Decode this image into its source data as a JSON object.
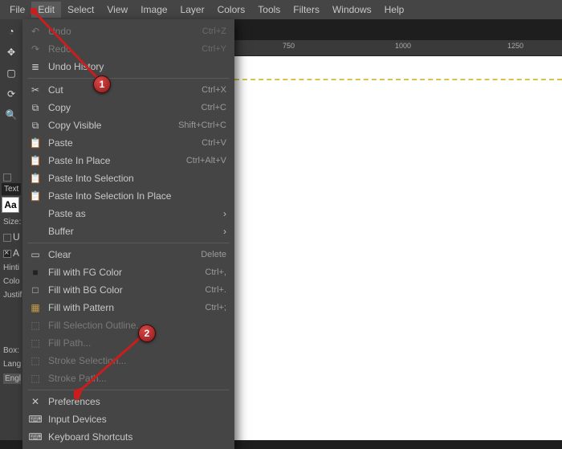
{
  "menubar": [
    "File",
    "Edit",
    "Select",
    "View",
    "Image",
    "Layer",
    "Colors",
    "Tools",
    "Filters",
    "Windows",
    "Help"
  ],
  "menubar_active_index": 1,
  "ruler_h": [
    "750",
    "1000",
    "1250"
  ],
  "ruler_positions": [
    60,
    200,
    340
  ],
  "dropdown": {
    "groups": [
      [
        {
          "icon": "undo",
          "label": "Undo",
          "shortcut": "Ctrl+Z",
          "disabled": true
        },
        {
          "icon": "redo",
          "label": "Redo",
          "shortcut": "Ctrl+Y",
          "disabled": true
        },
        {
          "icon": "history",
          "label": "Undo History",
          "shortcut": "",
          "disabled": false
        }
      ],
      [
        {
          "icon": "cut",
          "label": "Cut",
          "shortcut": "Ctrl+X",
          "disabled": false
        },
        {
          "icon": "copy",
          "label": "Copy",
          "shortcut": "Ctrl+C",
          "disabled": false
        },
        {
          "icon": "copy",
          "label": "Copy Visible",
          "shortcut": "Shift+Ctrl+C",
          "disabled": false
        },
        {
          "icon": "paste",
          "label": "Paste",
          "shortcut": "Ctrl+V",
          "disabled": false
        },
        {
          "icon": "paste",
          "label": "Paste In Place",
          "shortcut": "Ctrl+Alt+V",
          "disabled": false
        },
        {
          "icon": "paste",
          "label": "Paste Into Selection",
          "shortcut": "",
          "disabled": false
        },
        {
          "icon": "paste",
          "label": "Paste Into Selection In Place",
          "shortcut": "",
          "disabled": false
        },
        {
          "icon": "",
          "label": "Paste as",
          "shortcut": "",
          "disabled": false,
          "submenu": true
        },
        {
          "icon": "",
          "label": "Buffer",
          "shortcut": "",
          "disabled": false,
          "submenu": true
        }
      ],
      [
        {
          "icon": "clear",
          "label": "Clear",
          "shortcut": "Delete",
          "disabled": false
        },
        {
          "icon": "fgfill",
          "label": "Fill with FG Color",
          "shortcut": "Ctrl+,",
          "disabled": false
        },
        {
          "icon": "bgfill",
          "label": "Fill with BG Color",
          "shortcut": "Ctrl+.",
          "disabled": false
        },
        {
          "icon": "pattern",
          "label": "Fill with Pattern",
          "shortcut": "Ctrl+;",
          "disabled": false
        },
        {
          "icon": "stroke",
          "label": "Fill Selection Outline...",
          "shortcut": "",
          "disabled": true
        },
        {
          "icon": "stroke",
          "label": "Fill Path...",
          "shortcut": "",
          "disabled": true
        },
        {
          "icon": "stroke",
          "label": "Stroke Selection...",
          "shortcut": "",
          "disabled": true
        },
        {
          "icon": "stroke",
          "label": "Stroke Path...",
          "shortcut": "",
          "disabled": true
        }
      ],
      [
        {
          "icon": "prefs",
          "label": "Preferences",
          "shortcut": "",
          "disabled": false
        },
        {
          "icon": "devices",
          "label": "Input Devices",
          "shortcut": "",
          "disabled": false
        },
        {
          "icon": "kbd",
          "label": "Keyboard Shortcuts",
          "shortcut": "",
          "disabled": false
        }
      ]
    ]
  },
  "side": {
    "text_tab": "Text",
    "aa": "Aa",
    "size": "Size:",
    "u": "U",
    "a": "A",
    "hint": "Hinti",
    "color": "Colo",
    "justify": "Justif",
    "box": "Box:",
    "lang": "Lang",
    "eng": "Engl"
  },
  "badges": {
    "one": "1",
    "two": "2"
  }
}
